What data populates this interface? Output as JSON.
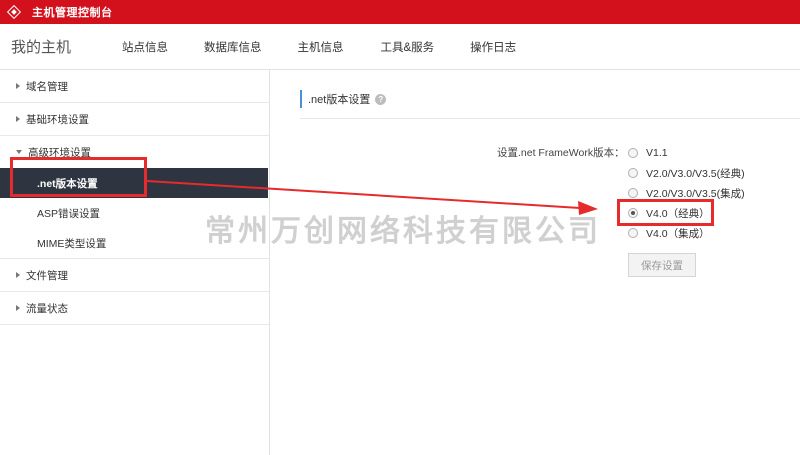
{
  "topbar": {
    "title": "主机管理控制台"
  },
  "navbar": {
    "brand": "我的主机",
    "tabs": [
      "站点信息",
      "数据库信息",
      "主机信息",
      "工具&服务",
      "操作日志"
    ]
  },
  "sidebar": {
    "domain": "域名管理",
    "basic_env": "基础环境设置",
    "advanced_env": "高级环境设置",
    "net_version": ".net版本设置",
    "asp_error": "ASP错误设置",
    "mime": "MIME类型设置",
    "files": "文件管理",
    "traffic": "流量状态"
  },
  "content": {
    "section_title": ".net版本设置",
    "help": "?",
    "form_label": "设置.net FrameWork版本：",
    "options": [
      "V1.1",
      "V2.0/V3.0/V3.5(经典)",
      "V2.0/V3.0/V3.5(集成)",
      "V4.0（经典）",
      "V4.0（集成）"
    ],
    "selected": "V4.0（经典）",
    "save_label": "保存设置"
  },
  "watermark": "常州万创网络科技有限公司",
  "colors": {
    "topbar": "#d3111c",
    "active_bg": "#2e3440",
    "highlight": "#e52b2b",
    "accent": "#4a90d9"
  }
}
